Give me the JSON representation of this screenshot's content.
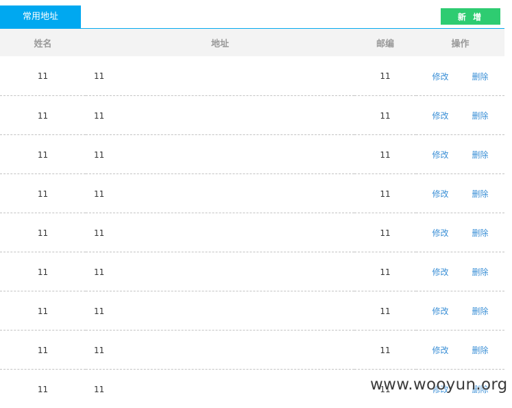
{
  "tabs": {
    "active_label": "常用地址"
  },
  "toolbar": {
    "add_label": "新 增"
  },
  "table": {
    "headers": {
      "name": "姓名",
      "address": "地址",
      "zip": "邮编",
      "ops": "操作"
    },
    "rows": [
      {
        "name": "11",
        "address": "11",
        "zip": "11",
        "edit": "修改",
        "delete": "删除"
      },
      {
        "name": "11",
        "address": "11",
        "zip": "11",
        "edit": "修改",
        "delete": "删除"
      },
      {
        "name": "11",
        "address": "11",
        "zip": "11",
        "edit": "修改",
        "delete": "删除"
      },
      {
        "name": "11",
        "address": "11",
        "zip": "11",
        "edit": "修改",
        "delete": "删除"
      },
      {
        "name": "11",
        "address": "11",
        "zip": "11",
        "edit": "修改",
        "delete": "删除"
      },
      {
        "name": "11",
        "address": "11",
        "zip": "11",
        "edit": "修改",
        "delete": "删除"
      },
      {
        "name": "11",
        "address": "11",
        "zip": "11",
        "edit": "修改",
        "delete": "删除"
      },
      {
        "name": "11",
        "address": "11",
        "zip": "11",
        "edit": "修改",
        "delete": "删除"
      },
      {
        "name": "11",
        "address": "11",
        "zip": "11",
        "edit": "修改",
        "delete": "删除"
      }
    ]
  },
  "watermark": "www.wooyun.org",
  "colors": {
    "tab_active": "#00a8f0",
    "add_button": "#2ecc71",
    "link": "#3a8fd6",
    "header_bg": "#f3f3f3"
  }
}
